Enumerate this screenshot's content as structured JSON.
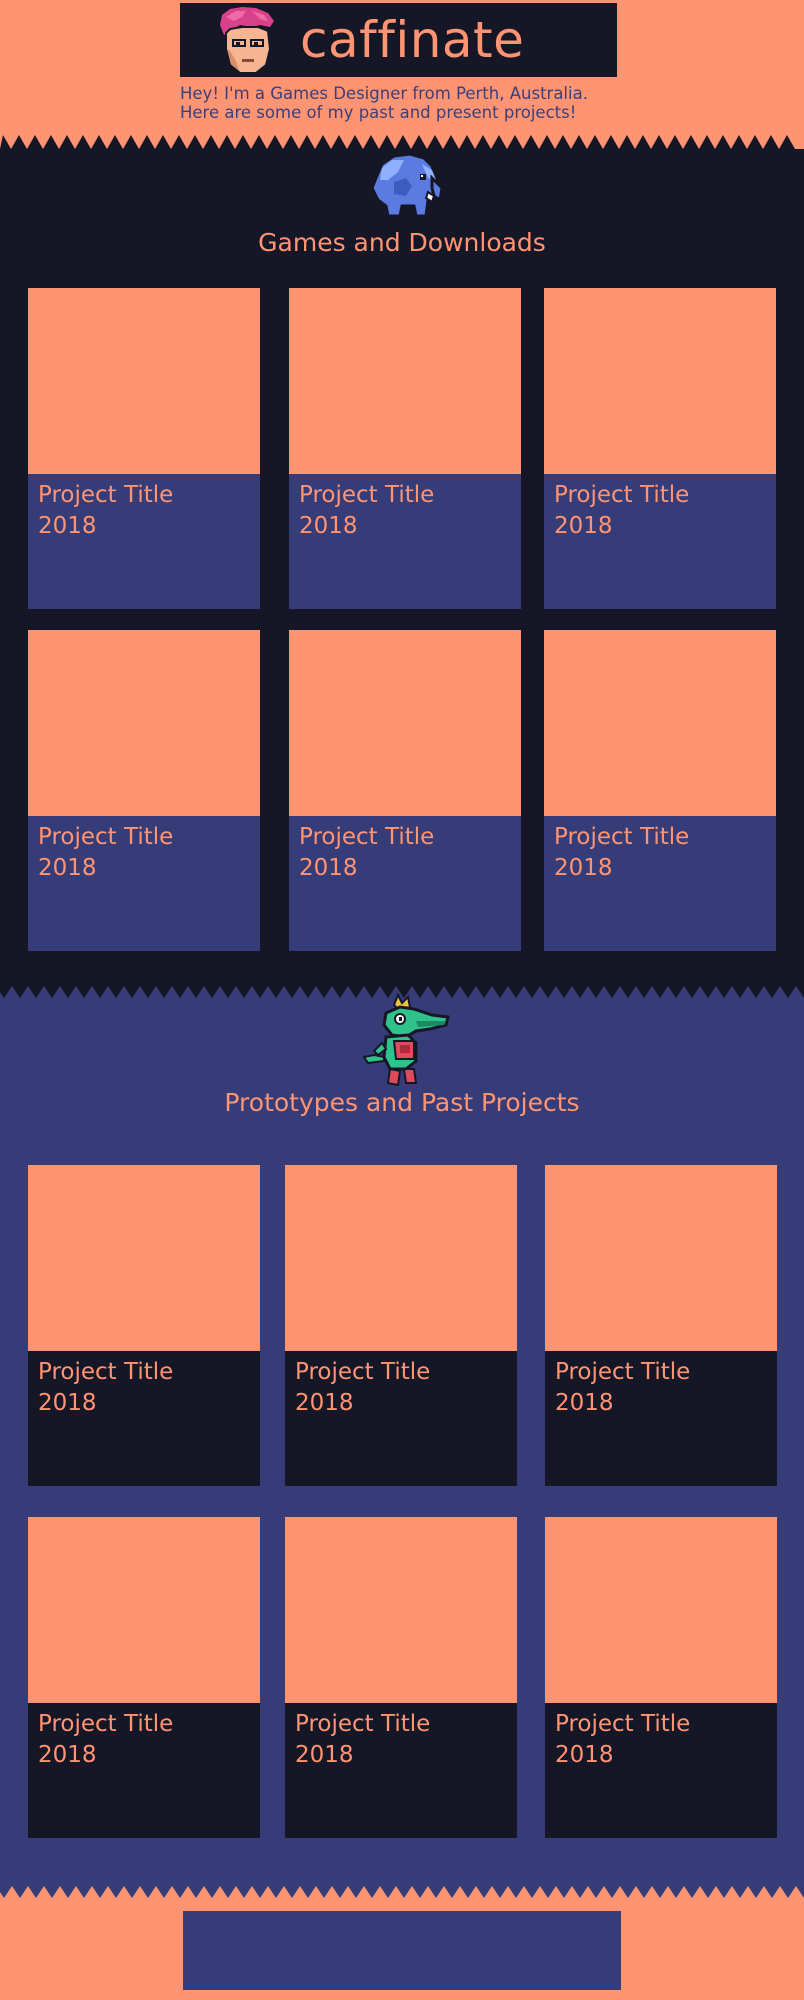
{
  "header": {
    "site_title": "caffinate",
    "intro_line_1": "Hey! I'm a Games Designer from Perth, Australia.",
    "intro_line_2": "Here are some of my past and present projects!"
  },
  "sections": {
    "games": {
      "title": "Games and Downloads",
      "mascot_icon": "elephant-icon",
      "cards": [
        {
          "title": "Project Title",
          "year": "2018"
        },
        {
          "title": "Project Title",
          "year": "2018"
        },
        {
          "title": "Project Title",
          "year": "2018"
        },
        {
          "title": "Project Title",
          "year": "2018"
        },
        {
          "title": "Project Title",
          "year": "2018"
        },
        {
          "title": "Project Title",
          "year": "2018"
        }
      ]
    },
    "protos": {
      "title": "Prototypes and Past Projects",
      "mascot_icon": "crocodile-icon",
      "cards": [
        {
          "title": "Project Title",
          "year": "2018"
        },
        {
          "title": "Project Title",
          "year": "2018"
        },
        {
          "title": "Project Title",
          "year": "2018"
        },
        {
          "title": "Project Title",
          "year": "2018"
        },
        {
          "title": "Project Title",
          "year": "2018"
        },
        {
          "title": "Project Title",
          "year": "2018"
        }
      ]
    }
  },
  "colors": {
    "peach": "#ff9473",
    "navy": "#161726",
    "indigo": "#363c77"
  }
}
